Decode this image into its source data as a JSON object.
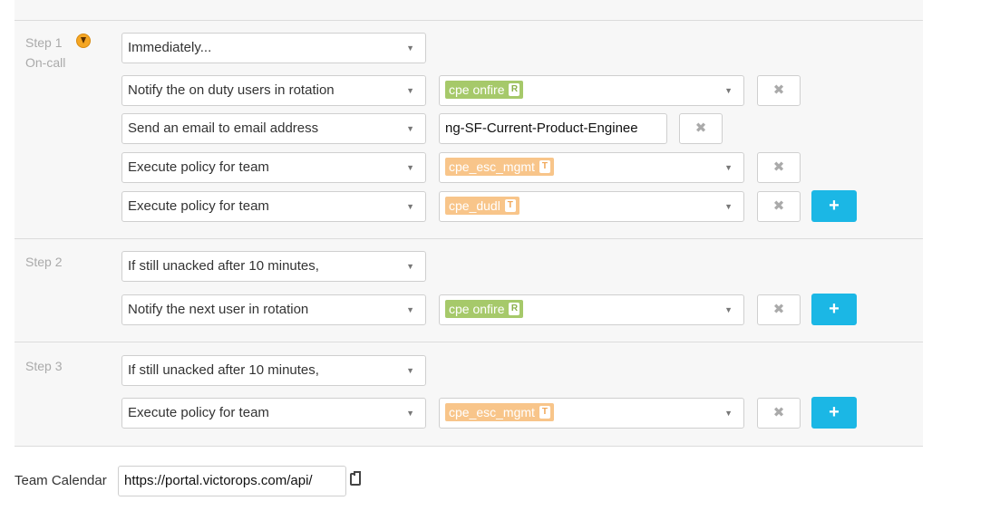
{
  "steps": [
    {
      "label": "Step 1",
      "sublabel": "On-call",
      "trigger": "Immediately...",
      "actions": [
        {
          "action": "Notify the on duty users in rotation",
          "target": "cpe onfire",
          "badge": "R"
        },
        {
          "action": "Send an email to email address",
          "input_value": "ng-SF-Current-Product-Enginee"
        },
        {
          "action": "Execute policy for team",
          "target": "cpe_esc_mgmt",
          "badge": "T"
        },
        {
          "action": "Execute policy for team",
          "target": "cpe_dudl",
          "badge": "T"
        }
      ]
    },
    {
      "label": "Step 2",
      "trigger": "If still unacked after 10 minutes,",
      "actions": [
        {
          "action": "Notify the next user in rotation",
          "target": "cpe onfire",
          "badge": "R"
        }
      ]
    },
    {
      "label": "Step 3",
      "trigger": "If still unacked after 10 minutes,",
      "actions": [
        {
          "action": "Execute policy for team",
          "target": "cpe_esc_mgmt",
          "badge": "T"
        }
      ]
    }
  ],
  "team_calendar": {
    "label": "Team Calendar",
    "url": "https://portal.victorops.com/api/"
  },
  "icons": {
    "remove": "✖",
    "add": "+",
    "dropdown": "▼"
  },
  "colors": {
    "rotation_tag": "#a6c96a",
    "team_tag": "#f8c58a",
    "add_button": "#1bb7e5"
  }
}
